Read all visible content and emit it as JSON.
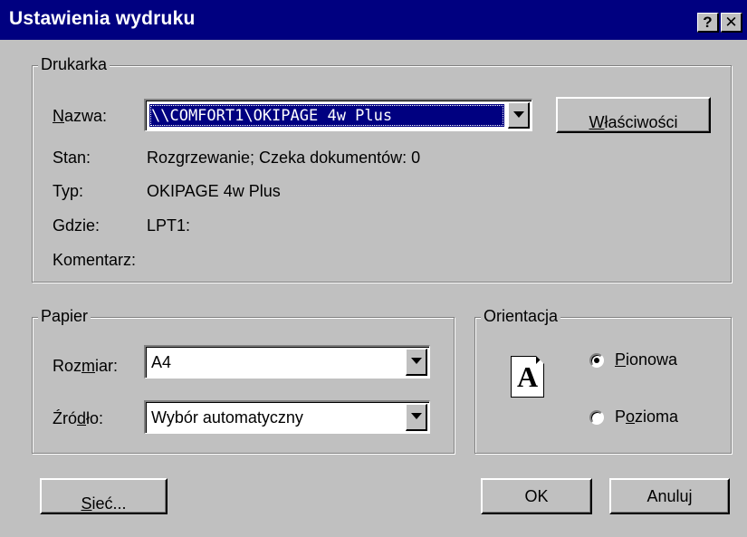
{
  "window": {
    "title": "Ustawienia wydruku",
    "help_glyph": "?",
    "close_glyph": "✕"
  },
  "printer": {
    "group_label": "Drukarka",
    "name_label_u": "N",
    "name_label_rest": "azwa:",
    "name_value": "\\\\COMFORT1\\OKIPAGE 4w Plus",
    "properties_u": "W",
    "properties_rest": "łaściwości",
    "status_label": "Stan:",
    "status_value": "Rozgrzewanie; Czeka dokumentów: 0",
    "type_label": "Typ:",
    "type_value": "OKIPAGE 4w Plus",
    "where_label": "Gdzie:",
    "where_value": "LPT1:",
    "comment_label": "Komentarz:"
  },
  "paper": {
    "group_label": "Papier",
    "size_label_pre": "Roz",
    "size_label_u": "m",
    "size_label_post": "iar:",
    "size_value": "A4",
    "source_label_pre": "Źró",
    "source_label_u": "d",
    "source_label_post": "ło:",
    "source_value": "Wybór automatyczny"
  },
  "orientation": {
    "group_label": "Orientacja",
    "page_glyph": "A",
    "portrait_u": "P",
    "portrait_rest": "ionowa",
    "landscape_pre": "P",
    "landscape_u": "o",
    "landscape_post": "zioma",
    "selected": "portrait"
  },
  "buttons": {
    "network_u": "S",
    "network_rest": "ieć...",
    "ok": "OK",
    "cancel": "Anuluj"
  }
}
